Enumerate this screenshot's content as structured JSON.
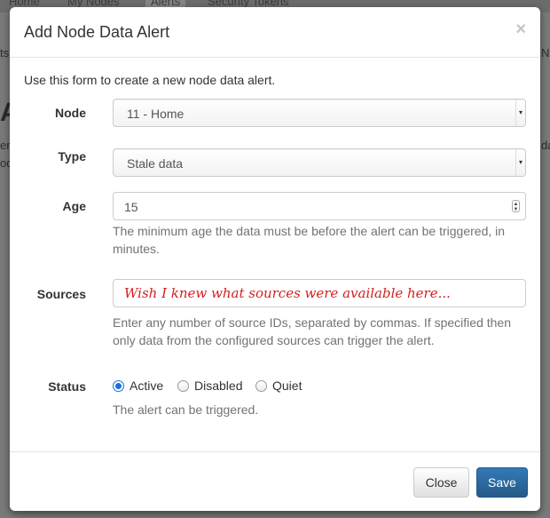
{
  "background": {
    "tabs": [
      "Home",
      "My Nodes",
      "Alerts",
      "Security Tokens"
    ],
    "fragments": [
      "ts",
      "No",
      "A",
      "er",
      "od",
      "da"
    ]
  },
  "modal": {
    "title": "Add Node Data Alert",
    "close_symbol": "×",
    "intro": "Use this form to create a new node data alert.",
    "fields": {
      "node": {
        "label": "Node",
        "value": "11 - Home"
      },
      "type": {
        "label": "Type",
        "value": "Stale data"
      },
      "age": {
        "label": "Age",
        "value": "15",
        "help": "The minimum age the data must be before the alert can be triggered, in minutes."
      },
      "sources": {
        "label": "Sources",
        "annotation": "Wish I knew what sources were available here...",
        "help": "Enter any number of source IDs, separated by commas. If specified then only data from the configured sources can trigger the alert."
      },
      "status": {
        "label": "Status",
        "options": [
          "Active",
          "Disabled",
          "Quiet"
        ],
        "selected": "Active",
        "help": "The alert can be triggered."
      }
    },
    "footer": {
      "close_label": "Close",
      "save_label": "Save"
    }
  },
  "colors": {
    "primary": "#337ab7",
    "annotation": "#d42020",
    "radio_checked": "#1a73d9"
  }
}
